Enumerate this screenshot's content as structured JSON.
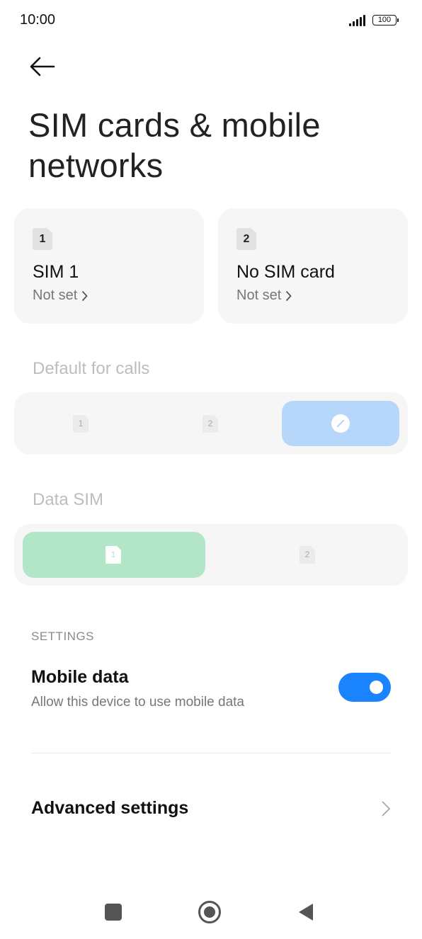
{
  "status_bar": {
    "time": "10:00",
    "battery": "100"
  },
  "header": {
    "title": "SIM cards & mobile networks"
  },
  "sim_cards": [
    {
      "slot": "1",
      "name": "SIM 1",
      "subtitle": "Not set"
    },
    {
      "slot": "2",
      "name": "No SIM card",
      "subtitle": "Not set"
    }
  ],
  "default_calls": {
    "label": "Default for calls",
    "options": [
      "1",
      "2"
    ],
    "selected": "ask-every-time"
  },
  "data_sim": {
    "label": "Data SIM",
    "options": [
      "1",
      "2"
    ],
    "selected": "1"
  },
  "settings": {
    "section_label": "SETTINGS",
    "mobile_data": {
      "title": "Mobile data",
      "description": "Allow this device to use mobile data",
      "enabled": true
    },
    "advanced": {
      "title": "Advanced settings"
    }
  },
  "colors": {
    "accent": "#1a84ff",
    "calls_selected": "#b6d6fa",
    "data_selected": "#b3e6c8"
  }
}
